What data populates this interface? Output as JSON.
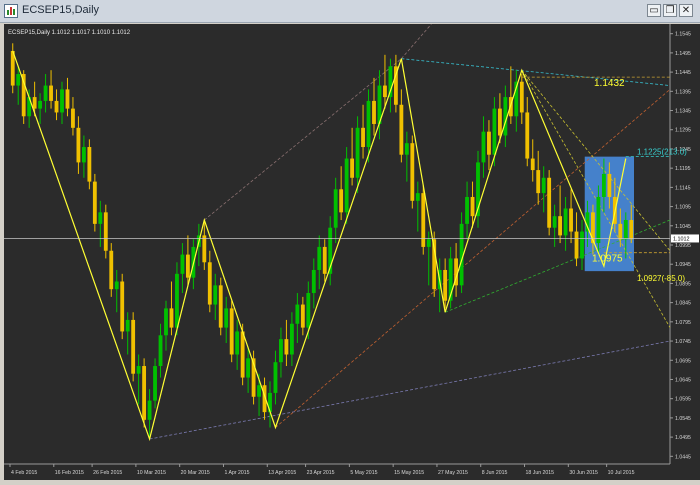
{
  "window": {
    "title": "ECSEP15,Daily",
    "minimize_glyph": "▭",
    "restore_glyph": "❐",
    "close_glyph": "✕"
  },
  "chart_header": "ECSEP15,Daily  1.1012 1.1017 1.1010 1.1012",
  "colors": {
    "background": "#2b2b2b",
    "bull": "#00c000",
    "bear": "#f0c000",
    "zigzag": "#ffff33",
    "cyan": "#38d0d0",
    "box": "#4a90e8",
    "price_line": "#c8c8c8"
  },
  "chart_data": {
    "type": "candlestick",
    "title": "ECSEP15,Daily",
    "ohlc_header": "1.1012 1.1017 1.1010 1.1012",
    "y_ticks": [
      "1.1545",
      "1.1495",
      "1.1445",
      "1.1395",
      "1.1345",
      "1.1295",
      "1.1245",
      "1.1195",
      "1.1145",
      "1.1095",
      "1.1045",
      "1.0995",
      "1.0945",
      "1.0895",
      "1.0845",
      "1.0795",
      "1.0745",
      "1.0695",
      "1.0645",
      "1.0595",
      "1.0545",
      "1.0495",
      "1.0445"
    ],
    "x_ticks": [
      "4 Feb 2015",
      "16 Feb 2015",
      "26 Feb 2015",
      "10 Mar 2015",
      "20 Mar 2015",
      "1 Apr 2015",
      "13 Apr 2015",
      "23 Apr 2015",
      "5 May 2015",
      "15 May 2015",
      "27 May 2015",
      "8 Jun 2015",
      "18 Jun 2015",
      "30 Jun 2015",
      "10 Jul 2015"
    ],
    "ylim": [
      1.0425,
      1.1565
    ],
    "current_price": "1.1012",
    "zigzag": [
      [
        0,
        1.15
      ],
      [
        25,
        1.049
      ],
      [
        35,
        1.106
      ],
      [
        48,
        1.052
      ],
      [
        71,
        1.148
      ],
      [
        79,
        1.082
      ],
      [
        93,
        1.145
      ],
      [
        108,
        1.094
      ],
      [
        112,
        1.122
      ]
    ],
    "annotations": [
      {
        "text": "1.1432",
        "y": 1.1432,
        "color": "#ffff33"
      },
      {
        "text": "1.0975",
        "y": 1.0975,
        "color": "#ffff33"
      },
      {
        "text": "1.1225(213.0)",
        "y": 1.1225,
        "color": "#38d0d0"
      },
      {
        "text": "1.0927(-85.0)",
        "y": 1.0927,
        "color": "#ffff33"
      }
    ],
    "candles": [
      [
        1.15,
        1.152,
        1.139,
        1.141
      ],
      [
        1.141,
        1.146,
        1.136,
        1.144
      ],
      [
        1.144,
        1.145,
        1.131,
        1.133
      ],
      [
        1.133,
        1.14,
        1.13,
        1.138
      ],
      [
        1.138,
        1.142,
        1.133,
        1.135
      ],
      [
        1.135,
        1.139,
        1.131,
        1.137
      ],
      [
        1.137,
        1.144,
        1.134,
        1.141
      ],
      [
        1.141,
        1.145,
        1.135,
        1.137
      ],
      [
        1.137,
        1.14,
        1.132,
        1.134
      ],
      [
        1.134,
        1.142,
        1.131,
        1.14
      ],
      [
        1.14,
        1.143,
        1.133,
        1.135
      ],
      [
        1.135,
        1.138,
        1.128,
        1.13
      ],
      [
        1.13,
        1.133,
        1.118,
        1.121
      ],
      [
        1.121,
        1.128,
        1.117,
        1.125
      ],
      [
        1.125,
        1.127,
        1.114,
        1.116
      ],
      [
        1.116,
        1.118,
        1.103,
        1.105
      ],
      [
        1.105,
        1.111,
        1.099,
        1.108
      ],
      [
        1.108,
        1.11,
        1.096,
        1.098
      ],
      [
        1.098,
        1.1,
        1.086,
        1.088
      ],
      [
        1.088,
        1.093,
        1.082,
        1.09
      ],
      [
        1.09,
        1.092,
        1.075,
        1.077
      ],
      [
        1.077,
        1.082,
        1.071,
        1.08
      ],
      [
        1.08,
        1.082,
        1.064,
        1.066
      ],
      [
        1.066,
        1.071,
        1.058,
        1.068
      ],
      [
        1.068,
        1.07,
        1.052,
        1.054
      ],
      [
        1.054,
        1.062,
        1.049,
        1.059
      ],
      [
        1.059,
        1.07,
        1.057,
        1.068
      ],
      [
        1.068,
        1.079,
        1.065,
        1.076
      ],
      [
        1.076,
        1.085,
        1.072,
        1.083
      ],
      [
        1.083,
        1.09,
        1.076,
        1.078
      ],
      [
        1.078,
        1.095,
        1.076,
        1.092
      ],
      [
        1.092,
        1.1,
        1.087,
        1.097
      ],
      [
        1.097,
        1.102,
        1.089,
        1.091
      ],
      [
        1.091,
        1.101,
        1.088,
        1.099
      ],
      [
        1.099,
        1.105,
        1.094,
        1.102
      ],
      [
        1.102,
        1.106,
        1.093,
        1.095
      ],
      [
        1.095,
        1.098,
        1.082,
        1.084
      ],
      [
        1.084,
        1.092,
        1.08,
        1.089
      ],
      [
        1.089,
        1.091,
        1.076,
        1.078
      ],
      [
        1.078,
        1.086,
        1.074,
        1.083
      ],
      [
        1.083,
        1.085,
        1.069,
        1.071
      ],
      [
        1.071,
        1.08,
        1.067,
        1.077
      ],
      [
        1.077,
        1.079,
        1.063,
        1.065
      ],
      [
        1.065,
        1.073,
        1.061,
        1.07
      ],
      [
        1.07,
        1.072,
        1.058,
        1.06
      ],
      [
        1.06,
        1.066,
        1.055,
        1.063
      ],
      [
        1.063,
        1.065,
        1.054,
        1.056
      ],
      [
        1.056,
        1.064,
        1.052,
        1.061
      ],
      [
        1.061,
        1.072,
        1.058,
        1.069
      ],
      [
        1.069,
        1.078,
        1.065,
        1.075
      ],
      [
        1.075,
        1.08,
        1.068,
        1.071
      ],
      [
        1.071,
        1.082,
        1.068,
        1.079
      ],
      [
        1.079,
        1.087,
        1.074,
        1.084
      ],
      [
        1.084,
        1.086,
        1.076,
        1.078
      ],
      [
        1.078,
        1.09,
        1.075,
        1.087
      ],
      [
        1.087,
        1.096,
        1.083,
        1.093
      ],
      [
        1.093,
        1.102,
        1.088,
        1.099
      ],
      [
        1.099,
        1.101,
        1.09,
        1.092
      ],
      [
        1.092,
        1.107,
        1.089,
        1.104
      ],
      [
        1.104,
        1.117,
        1.1,
        1.114
      ],
      [
        1.114,
        1.12,
        1.106,
        1.108
      ],
      [
        1.108,
        1.125,
        1.105,
        1.122
      ],
      [
        1.122,
        1.13,
        1.115,
        1.117
      ],
      [
        1.117,
        1.133,
        1.113,
        1.13
      ],
      [
        1.13,
        1.136,
        1.122,
        1.125
      ],
      [
        1.125,
        1.14,
        1.121,
        1.137
      ],
      [
        1.137,
        1.143,
        1.128,
        1.131
      ],
      [
        1.131,
        1.145,
        1.127,
        1.141
      ],
      [
        1.141,
        1.149,
        1.135,
        1.138
      ],
      [
        1.138,
        1.148,
        1.134,
        1.146
      ],
      [
        1.146,
        1.149,
        1.134,
        1.136
      ],
      [
        1.136,
        1.14,
        1.121,
        1.123
      ],
      [
        1.123,
        1.129,
        1.116,
        1.126
      ],
      [
        1.126,
        1.128,
        1.109,
        1.111
      ],
      [
        1.111,
        1.116,
        1.103,
        1.113
      ],
      [
        1.113,
        1.115,
        1.097,
        1.099
      ],
      [
        1.099,
        1.103,
        1.089,
        1.101
      ],
      [
        1.101,
        1.103,
        1.086,
        1.088
      ],
      [
        1.088,
        1.096,
        1.082,
        1.093
      ],
      [
        1.093,
        1.096,
        1.083,
        1.085
      ],
      [
        1.085,
        1.099,
        1.083,
        1.096
      ],
      [
        1.096,
        1.1,
        1.086,
        1.089
      ],
      [
        1.089,
        1.108,
        1.087,
        1.105
      ],
      [
        1.105,
        1.116,
        1.101,
        1.112
      ],
      [
        1.112,
        1.116,
        1.104,
        1.107
      ],
      [
        1.107,
        1.124,
        1.104,
        1.121
      ],
      [
        1.121,
        1.133,
        1.117,
        1.129
      ],
      [
        1.129,
        1.132,
        1.119,
        1.123
      ],
      [
        1.123,
        1.138,
        1.12,
        1.135
      ],
      [
        1.135,
        1.139,
        1.126,
        1.128
      ],
      [
        1.128,
        1.141,
        1.125,
        1.138
      ],
      [
        1.138,
        1.146,
        1.131,
        1.133
      ],
      [
        1.133,
        1.145,
        1.129,
        1.142
      ],
      [
        1.142,
        1.144,
        1.131,
        1.134
      ],
      [
        1.134,
        1.138,
        1.12,
        1.122
      ],
      [
        1.122,
        1.127,
        1.116,
        1.119
      ],
      [
        1.119,
        1.124,
        1.11,
        1.113
      ],
      [
        1.113,
        1.12,
        1.108,
        1.117
      ],
      [
        1.117,
        1.119,
        1.102,
        1.104
      ],
      [
        1.104,
        1.11,
        1.099,
        1.107
      ],
      [
        1.107,
        1.115,
        1.1,
        1.102
      ],
      [
        1.102,
        1.112,
        1.098,
        1.109
      ],
      [
        1.109,
        1.114,
        1.1,
        1.103
      ],
      [
        1.103,
        1.108,
        1.094,
        1.096
      ],
      [
        1.096,
        1.106,
        1.093,
        1.103
      ],
      [
        1.103,
        1.111,
        1.099,
        1.108
      ],
      [
        1.108,
        1.11,
        1.097,
        1.1
      ],
      [
        1.1,
        1.115,
        1.097,
        1.112
      ],
      [
        1.112,
        1.122,
        1.108,
        1.118
      ],
      [
        1.118,
        1.121,
        1.109,
        1.112
      ],
      [
        1.112,
        1.117,
        1.103,
        1.105
      ],
      [
        1.105,
        1.109,
        1.099,
        1.101
      ],
      [
        1.101,
        1.108,
        1.096,
        1.106
      ],
      [
        1.106,
        1.11,
        1.1,
        1.101
      ]
    ]
  }
}
